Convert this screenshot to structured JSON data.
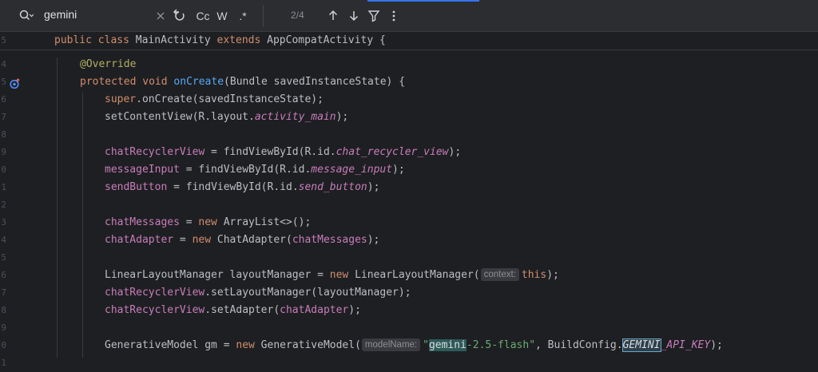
{
  "find_bar": {
    "query": "gemini",
    "clear_icon": "close-icon",
    "replace_toggle_icon": "replace-icon",
    "match_case_label": "Cc",
    "whole_words_label": "W",
    "regex_label": ".*",
    "match_counter": "2/4",
    "prev_icon": "arrow-up-icon",
    "next_icon": "arrow-down-icon",
    "filter_icon": "filter-icon",
    "more_icon": "more-vertical-icon"
  },
  "editor": {
    "sticky_line": {
      "number": "5",
      "text_public": "public",
      "text_class": "class",
      "class_name": "MainActivity",
      "text_extends": "extends",
      "super_class": "AppCompatActivity",
      "brace": "{"
    },
    "gutter_numbers": [
      "4",
      "5",
      "6",
      "7",
      "8",
      "9",
      "0",
      "1",
      "2",
      "3",
      "4",
      "5",
      "6",
      "7",
      "8",
      "9",
      "0",
      "1"
    ],
    "lines": {
      "override": "@Override",
      "oncreate": {
        "kw1": "protected",
        "kw2": "void",
        "name": "onCreate",
        "rest": "(Bundle savedInstanceState) {"
      },
      "super_call": {
        "kw": "super",
        "rest": ".onCreate(savedInstanceState);"
      },
      "set_content": {
        "pre": "setContentView(R.layout.",
        "field": "activity_main",
        "post": ");"
      },
      "rv_find": {
        "field": "chatRecyclerView",
        "pre": " = findViewById(R.id.",
        "id": "chat_recycler_view",
        "post": ");"
      },
      "mi_find": {
        "field": "messageInput",
        "pre": " = findViewById(R.id.",
        "id": "message_input",
        "post": ");"
      },
      "sb_find": {
        "field": "sendButton",
        "pre": " = findViewById(R.id.",
        "id": "send_button",
        "post": ");"
      },
      "messages": {
        "field": "chatMessages",
        "pre": " = ",
        "kw": "new",
        "post": " ArrayList<>();"
      },
      "adapter": {
        "field": "chatAdapter",
        "pre": " = ",
        "kw": "new",
        "mid": " ChatAdapter(",
        "arg": "chatMessages",
        "post": ");"
      },
      "llm": {
        "pre": "LinearLayoutManager layoutManager = ",
        "kw": "new",
        "mid": " LinearLayoutManager(",
        "hint": "context:",
        "kw2": "this",
        "post": ");"
      },
      "set_lm": {
        "field": "chatRecyclerView",
        "post": ".setLayoutManager(layoutManager);"
      },
      "set_adapter": {
        "field": "chatRecyclerView",
        "mid": ".setAdapter(",
        "arg": "chatAdapter",
        "post": ");"
      },
      "gm": {
        "pre": "GenerativeModel gm = ",
        "kw": "new",
        "mid": " GenerativeModel(",
        "hint": "modelName:",
        "q1": "\"",
        "match": "gemini",
        "str_rest": "-2.5-flash\"",
        "mid2": ", BuildConfig.",
        "key_match": "GEMINI",
        "key_rest": "_API_KEY",
        "post": ");"
      }
    }
  }
}
